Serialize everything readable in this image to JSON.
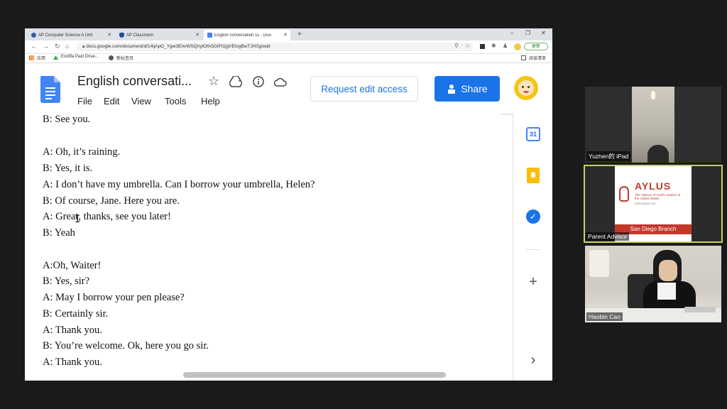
{
  "browser": {
    "tabs": [
      {
        "label": "AP Computer Science A Unit",
        "icon": "q-icon",
        "color": "#3b5ba5"
      },
      {
        "label": "AP Classroom",
        "icon": "shield-icon",
        "color": "#1f4e9c"
      },
      {
        "label": "English conversation 11 - Goo",
        "icon": "docs-icon",
        "color": "#4285f4",
        "active": true
      }
    ],
    "new_tab": "+",
    "controls": {
      "minimize": "–",
      "maximize": "❐",
      "close": "✕"
    },
    "url": "docs.google.com/document/d/14ijApO_Ygw3EhvWSQnylOfA5GiPt1jgVEtvgBwTJHSg/edit",
    "update_label": "更新",
    "bookmarks": [
      {
        "label": "应用"
      },
      {
        "label": "Exofifa Paid Drive..."
      },
      {
        "label": "新标签页"
      }
    ],
    "reading_list": "阅读清单"
  },
  "docs": {
    "title": "English conversati...",
    "menu": [
      "File",
      "Edit",
      "View",
      "Tools",
      "Help"
    ],
    "request_edit": "Request edit access",
    "share": "Share",
    "accent": "#1a73e8"
  },
  "document_lines": [
    "B: See you.",
    "",
    "A: Oh, it’s raining.",
    "B: Yes, it is.",
    "A: I don’t have my umbrella. Can I borrow your umbrella, Helen?",
    "B: Of course, Jane. Here you are.",
    "A: Great, thanks, see you later!",
    "B: Yeah",
    "",
    "A:Oh, Waiter!",
    "B: Yes, sir?",
    "A: May I borrow your pen please?",
    "B: Certainly sir.",
    "A: Thank you.",
    "B: You’re welcome. Ok, here you go sir.",
    "A: Thank you."
  ],
  "side_panel": {
    "calendar_day": "31",
    "icons": [
      "calendar-icon",
      "keep-icon",
      "tasks-icon",
      "add-icon",
      "expand-icon"
    ],
    "add": "+",
    "expand": "›"
  },
  "participants": [
    {
      "name": "Yuzhen的 iPad"
    },
    {
      "name": "Parent Advisor",
      "active": true,
      "slide": {
        "brand": "AYLUS",
        "subtitle": "The Alliance of Youth Leaders in the United States",
        "site": "www.aylus.org",
        "branch": "San Diego Branch"
      }
    },
    {
      "name": "Haobin Cao"
    }
  ]
}
